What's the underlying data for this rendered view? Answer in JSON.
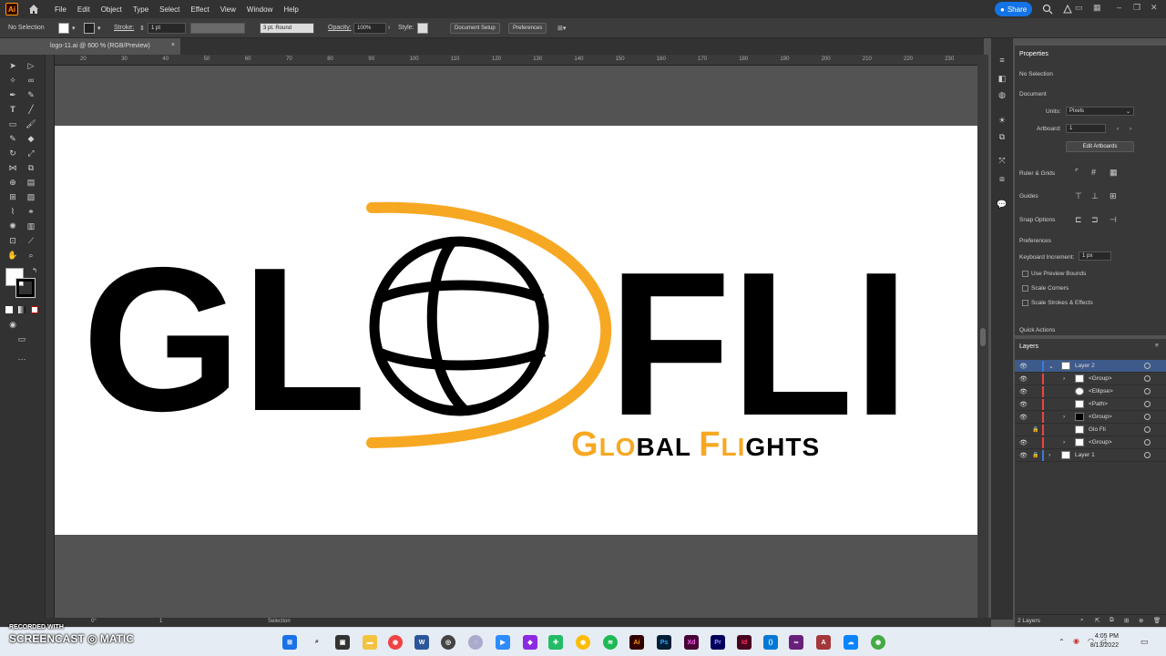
{
  "menubar": {
    "items": [
      "File",
      "Edit",
      "Object",
      "Type",
      "Select",
      "Effect",
      "View",
      "Window",
      "Help"
    ],
    "share_label": "Share"
  },
  "controlbar": {
    "selection_label": "No Selection",
    "stroke_label": "Stroke:",
    "stroke_value": "1 pt",
    "brush_value": "3 pt. Round",
    "opacity_label": "Opacity:",
    "opacity_value": "100%",
    "style_label": "Style:",
    "doc_setup_label": "Document Setup",
    "preferences_label": "Preferences"
  },
  "document": {
    "tab_title": "logo-11.ai @ 600 % (RGB/Preview)",
    "close_glyph": "×"
  },
  "ruler": {
    "ticks": [
      "20",
      "30",
      "40",
      "50",
      "60",
      "70",
      "80",
      "90",
      "100",
      "110",
      "120",
      "130",
      "140",
      "150",
      "160",
      "170",
      "180",
      "190",
      "200",
      "210",
      "220",
      "230"
    ]
  },
  "artwork": {
    "letters_left": "GL",
    "letters_right": "FLI",
    "tagline_part1": "G",
    "tagline_part2": "LO",
    "tagline_part3": "BAL ",
    "tagline_part4": "F",
    "tagline_part5": "LI",
    "tagline_part6": "GHTS",
    "accent_color": "#f7a823",
    "ink_color": "#000000"
  },
  "properties": {
    "title": "Properties",
    "selection": "No Selection",
    "document_heading": "Document",
    "units_label": "Units:",
    "units_value": "Pixels",
    "artboard_label": "Artboard:",
    "artboard_value": "1",
    "edit_artboards_label": "Edit Artboards",
    "ruler_grids_label": "Ruler & Grids",
    "guides_label": "Guides",
    "snap_options_label": "Snap Options",
    "preferences_heading": "Preferences",
    "keyboard_increment_label": "Keyboard Increment:",
    "keyboard_increment_value": "1 px",
    "use_preview_bounds": "Use Preview Bounds",
    "scale_corners": "Scale Corners",
    "scale_strokes": "Scale Strokes & Effects",
    "quick_actions": "Quick Actions"
  },
  "layers": {
    "title": "Layers",
    "rows": [
      {
        "name": "Layer 2",
        "selected": true
      },
      {
        "name": "<Group>",
        "selected": false
      },
      {
        "name": "<Ellipse>",
        "selected": false
      },
      {
        "name": "<Path>",
        "selected": false
      },
      {
        "name": "<Group>",
        "selected": false
      },
      {
        "name": "Glo Fli",
        "selected": false
      },
      {
        "name": "<Group>",
        "selected": false
      },
      {
        "name": "Layer 1",
        "selected": false
      }
    ],
    "count_label": "2 Layers"
  },
  "statusbar": {
    "zoom_value": "0°",
    "artboard_nav": "1",
    "tool_label": "Selection"
  },
  "taskbar": {
    "time": "4:05 PM",
    "date": "8/13/2022",
    "watermark_line1": "RECORDED WITH",
    "watermark_line2": "SCREENCAST",
    "watermark_line3": "MATIC",
    "apps": [
      "Ai",
      "Ps",
      "Xd",
      "Pr",
      "Id",
      "A"
    ]
  }
}
